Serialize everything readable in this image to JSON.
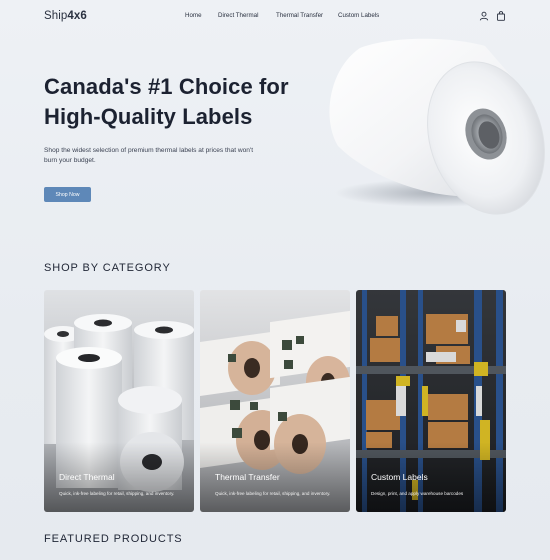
{
  "brand": {
    "name_prefix": "Ship",
    "name_bold": "4x6",
    "name_mark": "6"
  },
  "nav": {
    "links": [
      "Home",
      "Direct Thermal",
      "Thermal Transfer",
      "Custom Labels"
    ],
    "icons": [
      "user-icon",
      "shopping-bag-icon"
    ]
  },
  "hero": {
    "title": "Canada's #1 Choice for High-Quality Labels",
    "subtitle": "Shop the widest selection of premium thermal labels at prices that won't burn your budget.",
    "cta": "Shop Now",
    "accent_color": "#5e88b8"
  },
  "categories": {
    "heading": "SHOP BY CATEGORY",
    "items": [
      {
        "title": "Direct Thermal",
        "desc": "Quick, ink-free labeling for retail, shipping, and inventory."
      },
      {
        "title": "Thermal Transfer",
        "desc": "Quick, ink-free labeling for retail, shipping, and inventory."
      },
      {
        "title": "Custom Labels",
        "desc": "Design, print, and apply warehouse barcodes"
      }
    ]
  },
  "featured": {
    "heading": "FEATURED PRODUCTS"
  }
}
